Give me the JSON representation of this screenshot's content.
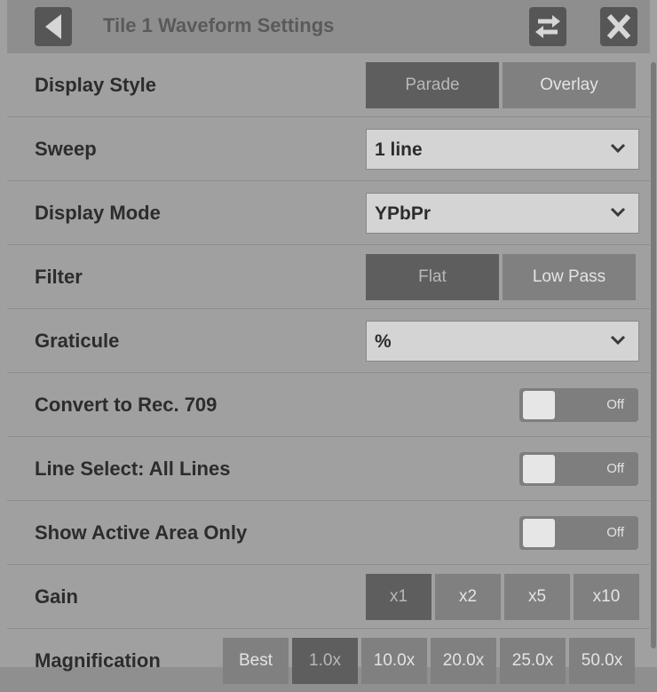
{
  "title": "Tile 1 Waveform Settings",
  "icons": {
    "back": "left-triangle-icon",
    "swap": "swap-arrows-icon",
    "close": "close-x-icon",
    "dropdown": "chevron-down-icon"
  },
  "rows": {
    "display_style": {
      "label": "Display Style",
      "options": [
        "Parade",
        "Overlay"
      ],
      "selected": "Parade"
    },
    "sweep": {
      "label": "Sweep",
      "value": "1 line"
    },
    "display_mode": {
      "label": "Display Mode",
      "value": "YPbPr"
    },
    "filter": {
      "label": "Filter",
      "options": [
        "Flat",
        "Low Pass"
      ],
      "selected": "Flat"
    },
    "graticule": {
      "label": "Graticule",
      "value": "%"
    },
    "convert_rec709": {
      "label": "Convert to Rec. 709",
      "state": "Off"
    },
    "line_select": {
      "label": "Line Select: All Lines",
      "state": "Off"
    },
    "active_area": {
      "label": "Show Active Area Only",
      "state": "Off"
    },
    "gain": {
      "label": "Gain",
      "options": [
        "x1",
        "x2",
        "x5",
        "x10"
      ],
      "selected": "x1"
    },
    "magnification": {
      "label": "Magnification",
      "options": [
        "Best",
        "1.0x",
        "10.0x",
        "20.0x",
        "25.0x",
        "50.0x"
      ],
      "selected": "1.0x"
    }
  },
  "colors": {
    "selected": "#5e5e5e",
    "unselected": "#808080",
    "panel": "#a0a0a0",
    "titlebar": "#8e8e8e"
  }
}
